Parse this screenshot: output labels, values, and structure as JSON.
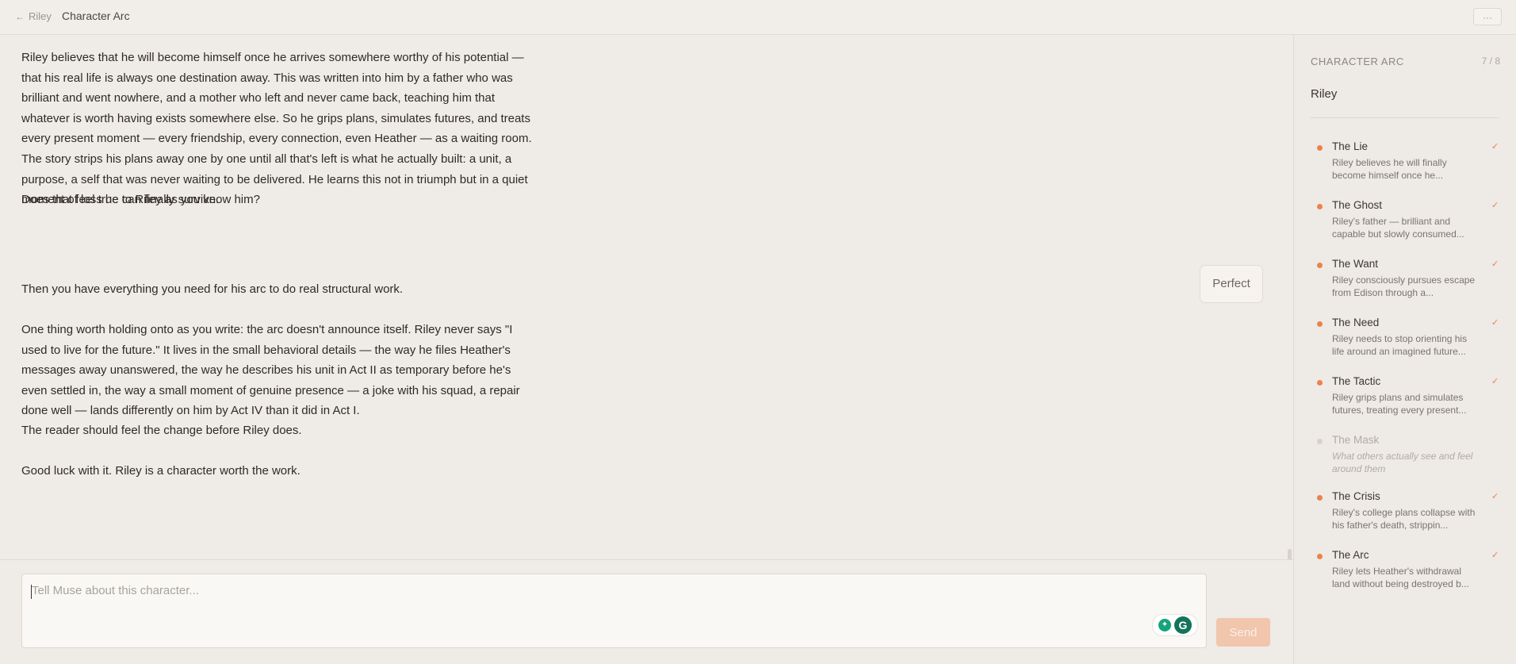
{
  "topbar": {
    "back_label": "Riley",
    "title": "Character Arc",
    "more_label": "···"
  },
  "chat": {
    "assistant_para_1": "Riley believes that he will become himself once he arrives somewhere worthy of his potential — that his real life is always one destination away. This was written into him by a father who was brilliant and went nowhere, and a mother who left and never came back, teaching him that whatever is worth having exists somewhere else. So he grips plans, simulates futures, and treats every present moment — every friendship, every connection, even Heather — as a waiting room. The story strips his plans away one by one until all that's left is what he actually built: a unit, a purpose, a self that was never waiting to be delivered. He learns this not in triumph but in a quiet moment of loss he can finally survive.",
    "assistant_para_2": "Does that feel true to Riley as you know him?",
    "user_reply": "Perfect",
    "assistant_para_3": "Then you have everything you need for his arc to do real structural work.",
    "assistant_para_4": "One thing worth holding onto as you write: the arc doesn't announce itself. Riley never says \"I used to live for the future.\" It lives in the small behavioral details — the way he files Heather's messages away unanswered, the way he describes his unit in Act II as temporary before he's even settled in, the way a small moment of genuine presence — a joke with his squad, a repair done well — lands differently on him by Act IV than it did in Act I.",
    "assistant_para_5": "The reader should feel the change before Riley does.",
    "assistant_para_6": "Good luck with it. Riley is a character worth the work."
  },
  "composer": {
    "placeholder": "Tell Muse about this character...",
    "value": "",
    "send_label": "Send"
  },
  "sidebar": {
    "title": "CHARACTER ARC",
    "progress": "7 / 8",
    "character": "Riley",
    "steps": [
      {
        "title": "The Lie",
        "desc": "Riley believes he will finally become himself once he...",
        "status": "complete"
      },
      {
        "title": "The Ghost",
        "desc": "Riley's father — brilliant and capable but slowly consumed...",
        "status": "complete"
      },
      {
        "title": "The Want",
        "desc": "Riley consciously pursues escape from Edison through a...",
        "status": "complete"
      },
      {
        "title": "The Need",
        "desc": "Riley needs to stop orienting his life around an imagined future...",
        "status": "complete"
      },
      {
        "title": "The Tactic",
        "desc": "Riley grips plans and simulates futures, treating every present...",
        "status": "complete"
      },
      {
        "title": "The Mask",
        "desc": "What others actually see and feel around them",
        "status": "pending"
      },
      {
        "title": "The Crisis",
        "desc": "Riley's college plans collapse with his father's death, strippin...",
        "status": "complete"
      },
      {
        "title": "The Arc",
        "desc": "Riley lets Heather's withdrawal land without being destroyed b...",
        "status": "complete"
      }
    ]
  },
  "colors": {
    "accent": "#e9834d",
    "send_disabled": "#f1c6ad",
    "background": "#efebe6"
  },
  "icons": {
    "back": "arrow-left-icon",
    "more": "more-horizontal-icon",
    "check": "check-icon",
    "bulb": "lightbulb-icon",
    "grammarly": "grammarly-icon"
  }
}
